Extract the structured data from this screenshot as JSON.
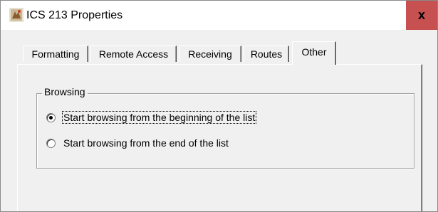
{
  "window": {
    "title": "ICS 213 Properties",
    "close_glyph": "x",
    "icon": "application-icon"
  },
  "tabs": [
    {
      "label": "Formatting",
      "active": false
    },
    {
      "label": "Remote Access",
      "active": false
    },
    {
      "label": "Receiving",
      "active": false
    },
    {
      "label": "Routes",
      "active": false
    },
    {
      "label": "Other",
      "active": true
    }
  ],
  "browsing": {
    "group_label": "Browsing",
    "options": [
      {
        "label": "Start browsing from the beginning of the list",
        "selected": true,
        "focused": true
      },
      {
        "label": "Start browsing from the end of the list",
        "selected": false,
        "focused": false
      }
    ]
  },
  "colors": {
    "close_button": "#c75050",
    "titlebar": "#ffffff",
    "dialog_background": "#f0f0f0"
  }
}
